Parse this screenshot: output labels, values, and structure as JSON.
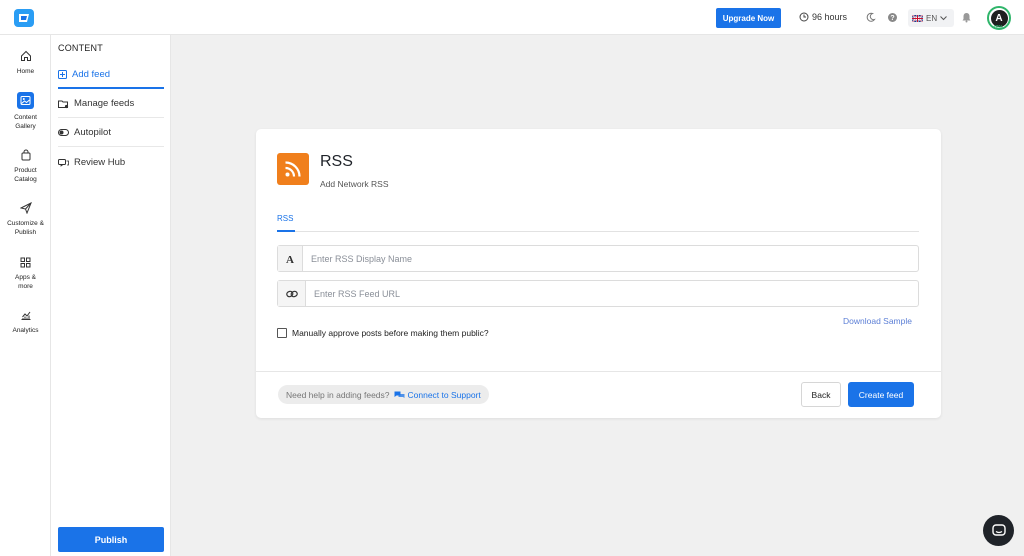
{
  "topbar": {
    "upgrade_label": "Upgrade Now",
    "hours_label": "96 hours",
    "language": "EN",
    "avatar_initial": "A",
    "avatar_progress": "40%"
  },
  "leftnav": {
    "items": [
      {
        "label": "Home",
        "icon": "home-icon"
      },
      {
        "label": "Content Gallery",
        "icon": "image-icon",
        "active": true
      },
      {
        "label": "Product Catalog",
        "icon": "bag-icon"
      },
      {
        "label": "Customize & Publish",
        "icon": "send-icon"
      },
      {
        "label": "Apps & more",
        "icon": "grid-icon"
      },
      {
        "label": "Analytics",
        "icon": "chart-icon"
      }
    ]
  },
  "subnav": {
    "title": "CONTENT",
    "items": [
      {
        "label": "Add feed",
        "icon": "plus-square-icon",
        "active": true
      },
      {
        "label": "Manage feeds",
        "icon": "folder-gear-icon"
      },
      {
        "label": "Autopilot",
        "icon": "toggle-icon"
      },
      {
        "label": "Review Hub",
        "icon": "reviews-icon"
      }
    ],
    "publish_label": "Publish"
  },
  "card": {
    "title": "RSS",
    "subtitle": "Add Network RSS",
    "tab_label": "RSS",
    "display_name_placeholder": "Enter RSS Display Name",
    "feed_url_placeholder": "Enter RSS Feed URL",
    "download_sample": "Download Sample",
    "approve_label": "Manually approve posts before making them public?",
    "help_text": "Need help in adding feeds?",
    "help_link": "Connect to Support",
    "back_label": "Back",
    "create_label": "Create feed"
  },
  "colors": {
    "accent": "#1a73e8",
    "rss_orange": "#f07f1c",
    "progress_green": "#2fb56a"
  }
}
